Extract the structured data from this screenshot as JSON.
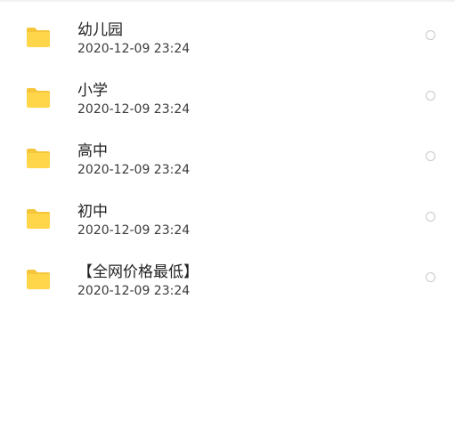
{
  "folders": [
    {
      "name": "幼儿园",
      "date": "2020-12-09 23:24"
    },
    {
      "name": "小学",
      "date": "2020-12-09 23:24"
    },
    {
      "name": "高中",
      "date": "2020-12-09 23:24"
    },
    {
      "name": "初中",
      "date": "2020-12-09 23:24"
    },
    {
      "name": "【全网价格最低】",
      "date": "2020-12-09 23:24"
    }
  ],
  "icons": {
    "folder": "folder-icon",
    "select": "radio-unchecked-icon"
  },
  "colors": {
    "folder": "#FFD54A",
    "folder_tab": "#F5C53A",
    "radio_border": "#C8C8C8"
  }
}
